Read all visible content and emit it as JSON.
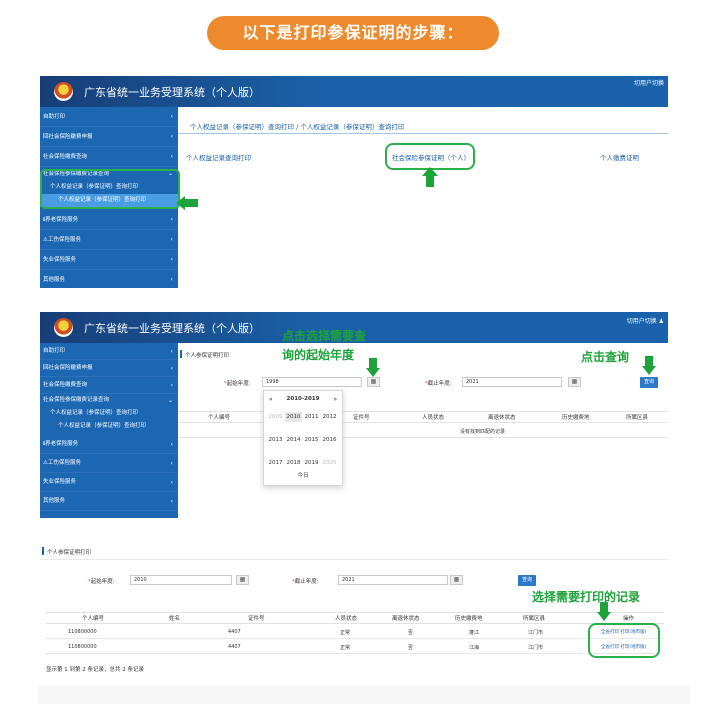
{
  "banner": {
    "text": "以下是打印参保证明的步骤："
  },
  "system_title": "广东省统一业务受理系统（个人版）",
  "user_switch_1": "切用户切换",
  "user_switch_2": "切用户切换 ♟",
  "sidebar_top": {
    "items": [
      "自助打印",
      "回社会保险缴费申报",
      "社会保险缴费查询",
      "社会保险参保缴费记录查询"
    ],
    "sub": "个人权益记录（参保证明）查询打印",
    "sub2": "个人权益记录（参保证明）查询打印",
    "items_after": [
      "养老保险服务",
      "工伤保险服务",
      "失业保险服务",
      "其他服务"
    ]
  },
  "sidebar_mid": {
    "items": [
      "自助打印",
      "回社会保险缴费申报",
      "社会保险缴费查询",
      "社会保险参保缴费记录查询"
    ],
    "sub": "个人权益记录（参保证明）查询打印",
    "sub2": "个人权益记录（参保证明）查询打印",
    "items_after": [
      "养老保险服务",
      "工伤保险服务",
      "失业保险服务",
      "其他服务"
    ]
  },
  "panel1": {
    "breadcrumb": "个人权益记录（参保证明）查询打印 /  个人权益记录（参保证明）查询打印",
    "tabs": [
      "个人权益记录查询打印",
      "社会保险参保证明（个人）",
      "个人缴费证明"
    ]
  },
  "panel2": {
    "section_title": "个人参保证明打印",
    "start_label": "起始年度:",
    "end_label": "截止年度:",
    "start_value": "1998",
    "end_value": "2021",
    "query_label": "查询",
    "headers": [
      "个人编号",
      "证件号",
      "人员状态",
      "离退休状态",
      "历史缴费地",
      "所属区县"
    ],
    "empty_text": "没有找到匹配的记录",
    "callout_start_1": "点击选择需要查",
    "callout_start_2": "询的起始年度",
    "callout_query": "点击查询",
    "datepicker": {
      "prev": "«",
      "next": "»",
      "range": "2010-2019",
      "years": [
        "2009",
        "2010",
        "2011",
        "2012",
        "2013",
        "2014",
        "2015",
        "2016",
        "2017",
        "2018",
        "2019",
        "2020"
      ],
      "today": "今日"
    }
  },
  "panel3": {
    "section_title": "个人参保证明打印",
    "start_label": "起始年度:",
    "end_label": "截止年度:",
    "start_value": "2010",
    "end_value": "2021",
    "query_label": "查询",
    "callout": "选择需要打印的记录",
    "headers": [
      "个人编号",
      "姓名",
      "证件号",
      "人员状态",
      "离退休状态",
      "历史缴费地",
      "所属区县",
      "操作"
    ],
    "rows": [
      {
        "id": "110800000",
        "name": "",
        "cert": "4407",
        "status": "正常",
        "retire": "否",
        "history": "蓬江",
        "district": "江门市",
        "op": "全省打印 打印(地市版)"
      },
      {
        "id": "110800000",
        "name": "",
        "cert": "4407",
        "status": "正常",
        "retire": "否",
        "history": "江海",
        "district": "江门市",
        "op": "全省打印 打印(地市版)"
      }
    ],
    "footer": "显示第 1 到第 2 条记录，总共 2 条记录"
  }
}
